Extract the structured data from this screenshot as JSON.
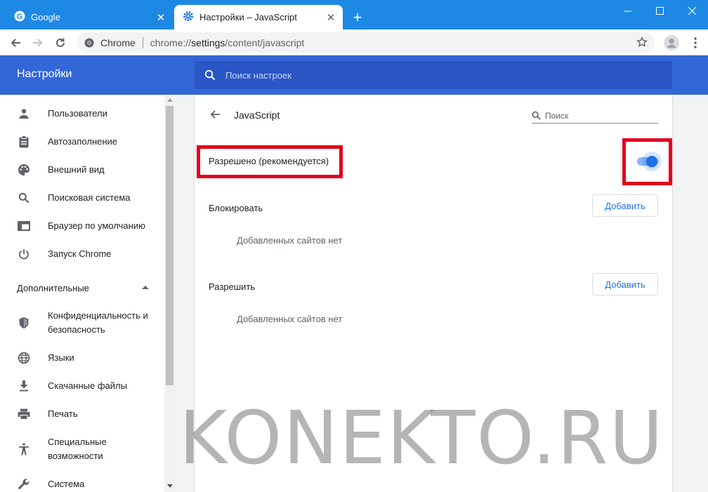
{
  "browser": {
    "tabs": [
      {
        "title": "Google",
        "active": false
      },
      {
        "title": "Настройки – JavaScript",
        "active": true
      }
    ],
    "new_tab_symbol": "+",
    "window_controls": {
      "minimize": "—",
      "maximize": "☐",
      "close": "✕"
    },
    "omnibox": {
      "site_label": "Chrome",
      "url_scheme": "chrome://",
      "url_host": "settings",
      "url_path": "/content/javascript"
    }
  },
  "settings": {
    "title": "Настройки",
    "search_placeholder": "Поиск настроек",
    "sidebar": {
      "items": [
        {
          "label": "Пользователи",
          "icon": "person-icon"
        },
        {
          "label": "Автозаполнение",
          "icon": "clipboard-icon"
        },
        {
          "label": "Внешний вид",
          "icon": "palette-icon"
        },
        {
          "label": "Поисковая система",
          "icon": "search-icon"
        },
        {
          "label": "Браузер по умолчанию",
          "icon": "browser-window-icon"
        },
        {
          "label": "Запуск Chrome",
          "icon": "power-icon"
        }
      ],
      "advanced_label": "Дополнительные",
      "advanced_items": [
        {
          "label": "Конфиденциальность и безопасность",
          "icon": "shield-icon"
        },
        {
          "label": "Языки",
          "icon": "globe-icon"
        },
        {
          "label": "Скачанные файлы",
          "icon": "download-icon"
        },
        {
          "label": "Печать",
          "icon": "printer-icon"
        },
        {
          "label": "Специальные возможности",
          "icon": "accessibility-icon"
        },
        {
          "label": "Система",
          "icon": "wrench-icon"
        }
      ]
    },
    "page": {
      "heading": "JavaScript",
      "search_placeholder": "Поиск",
      "allowed_label": "Разрешено (рекомендуется)",
      "allowed_enabled": true,
      "block": {
        "label": "Блокировать",
        "add_button": "Добавить",
        "empty_text": "Добавленных сайтов нет"
      },
      "allow": {
        "label": "Разрешить",
        "add_button": "Добавить",
        "empty_text": "Добавленных сайтов нет"
      }
    },
    "watermark": "KONEKTO.RU"
  },
  "colors": {
    "titlebar": "#1e88e5",
    "settings_header": "#3367d6",
    "accent": "#1a73e8",
    "highlight": "#e0001b"
  }
}
